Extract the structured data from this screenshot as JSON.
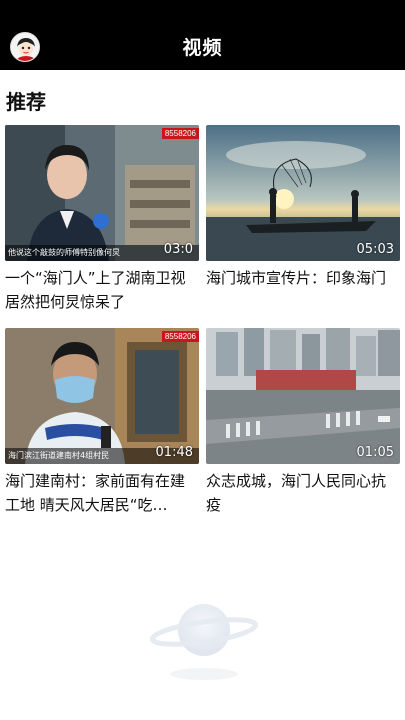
{
  "header": {
    "title": "视频"
  },
  "section": {
    "title": "推荐"
  },
  "videos": [
    {
      "title": "一个“海门人”上了湖南卫视 居然把何炅惊呆了",
      "duration": "03:0",
      "badge": "8558206",
      "caption": "他说这个敲鼓的师傅特别像何炅"
    },
    {
      "title": "海门城市宣传片：印象海门",
      "duration": "05:03"
    },
    {
      "title": "海门建南村：家前面有在建工地 晴天风大居民“吃…",
      "duration": "01:48",
      "badge": "8558206",
      "caption": "海门滨江街道建南村4组村民"
    },
    {
      "title": "众志成城，海门人民同心抗疫",
      "duration": "01:05"
    }
  ],
  "colors": {
    "header_bg": "#000000",
    "badge_red": "#c8161d"
  }
}
